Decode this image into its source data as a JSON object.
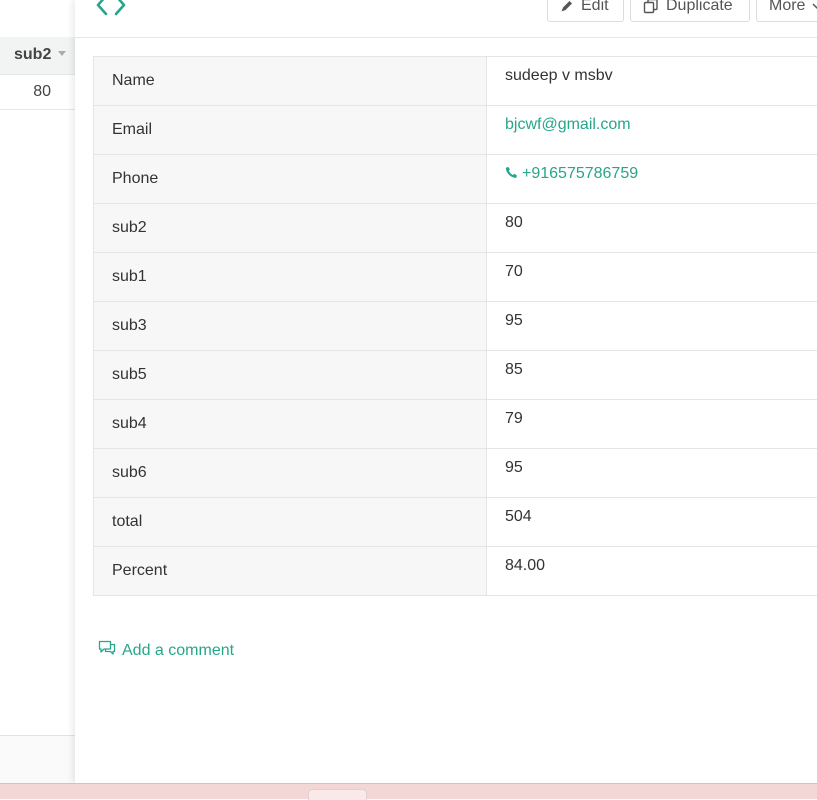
{
  "background_sheet": {
    "column_header": "sub2",
    "row_value": "80"
  },
  "toolbar": {
    "edit_label": "Edit",
    "duplicate_label": "Duplicate",
    "more_label": "More"
  },
  "record": {
    "rows": [
      {
        "label": "Name",
        "value": "sudeep v msbv"
      },
      {
        "label": "Email",
        "value": "bjcwf@gmail.com"
      },
      {
        "label": "Phone",
        "value": "+916575786759"
      },
      {
        "label": "sub2",
        "value": "80"
      },
      {
        "label": "sub1",
        "value": "70"
      },
      {
        "label": "sub3",
        "value": "95"
      },
      {
        "label": "sub5",
        "value": "85"
      },
      {
        "label": "sub4",
        "value": "79"
      },
      {
        "label": "sub6",
        "value": "95"
      },
      {
        "label": "total",
        "value": "504"
      },
      {
        "label": "Percent",
        "value": "84.00"
      }
    ]
  },
  "comments": {
    "add_label": "Add a comment"
  },
  "colors": {
    "accent": "#26a68a",
    "label_bg": "#f6f7f6",
    "border": "#e4e6e5"
  },
  "icons": {
    "header": "code-icon",
    "edit": "pencil-icon",
    "duplicate": "duplicate-icon",
    "more": "chevron-down-icon",
    "phone": "phone-icon",
    "comment": "comment-icon"
  }
}
